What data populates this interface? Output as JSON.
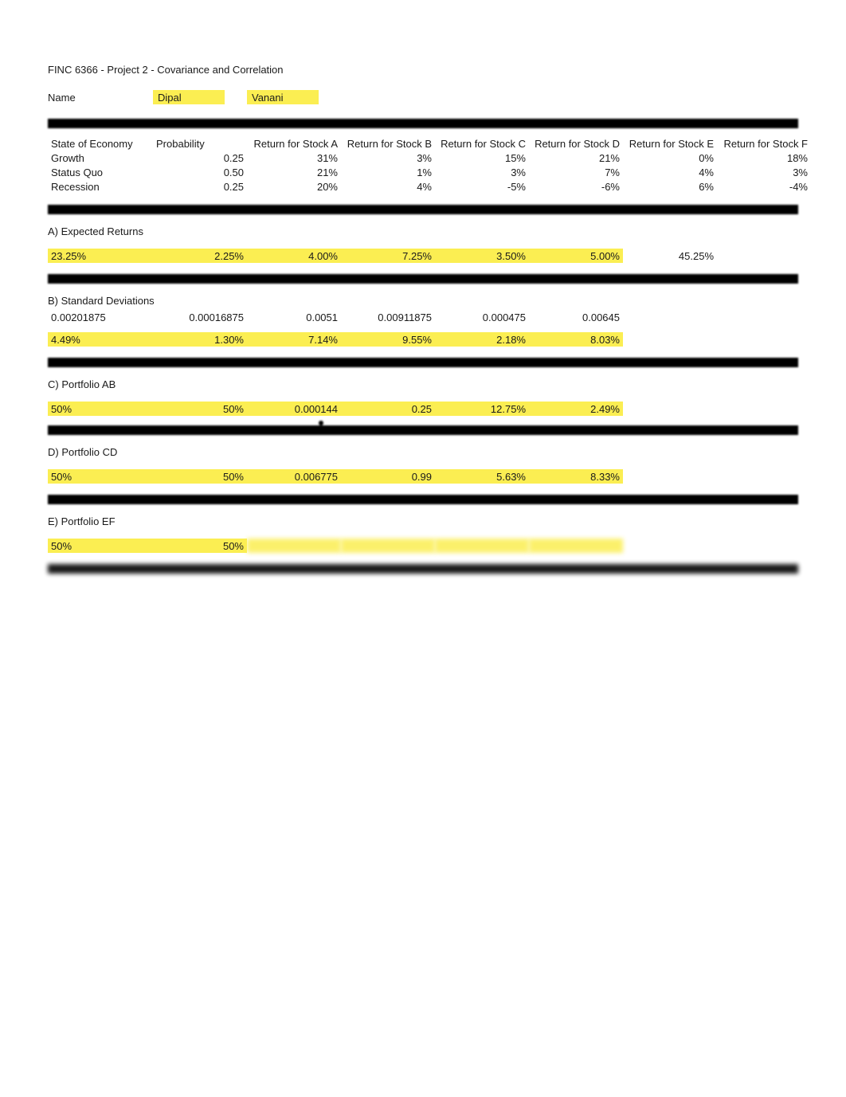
{
  "title": "FINC 6366 - Project 2 - Covariance and Correlation",
  "name_label": "Name",
  "name_first": "Dipal",
  "name_last": "Vanani",
  "header": {
    "c0": "State of Economy",
    "c1": "Probability",
    "c2": "Return for Stock A",
    "c3": "Return for Stock B",
    "c4": "Return for Stock C",
    "c5": "Return for Stock D",
    "c6": "Return for Stock E",
    "c7": "Return for Stock F"
  },
  "rows": [
    {
      "c0": "Growth",
      "c1": "0.25",
      "c2": "31%",
      "c3": "3%",
      "c4": "15%",
      "c5": "21%",
      "c6": "0%",
      "c7": "18%"
    },
    {
      "c0": "Status Quo",
      "c1": "0.50",
      "c2": "21%",
      "c3": "1%",
      "c4": "3%",
      "c5": "7%",
      "c6": "4%",
      "c7": "3%"
    },
    {
      "c0": "Recession",
      "c1": "0.25",
      "c2": "20%",
      "c3": "4%",
      "c4": "-5%",
      "c5": "-6%",
      "c6": "6%",
      "c7": "-4%"
    }
  ],
  "sectionA": {
    "title": "A) Expected Returns",
    "vals": [
      "23.25%",
      "2.25%",
      "4.00%",
      "7.25%",
      "3.50%",
      "5.00%",
      "45.25%"
    ]
  },
  "sectionB": {
    "title": "B) Standard Deviations",
    "raw": [
      "0.00201875",
      "0.00016875",
      "0.0051",
      "0.00911875",
      "0.000475",
      "0.00645"
    ],
    "vals": [
      "4.49%",
      "1.30%",
      "7.14%",
      "9.55%",
      "2.18%",
      "8.03%"
    ]
  },
  "sectionC": {
    "title": "C) Portfolio AB",
    "vals": [
      "50%",
      "50%",
      "0.000144",
      "0.25",
      "12.75%",
      "2.49%"
    ]
  },
  "sectionD": {
    "title": "D) Portfolio CD",
    "vals": [
      "50%",
      "50%",
      "0.006775",
      "0.99",
      "5.63%",
      "8.33%"
    ]
  },
  "sectionE": {
    "title": "E) Portfolio EF",
    "vals": [
      "50%",
      "50%",
      "",
      "",
      "",
      ""
    ]
  }
}
